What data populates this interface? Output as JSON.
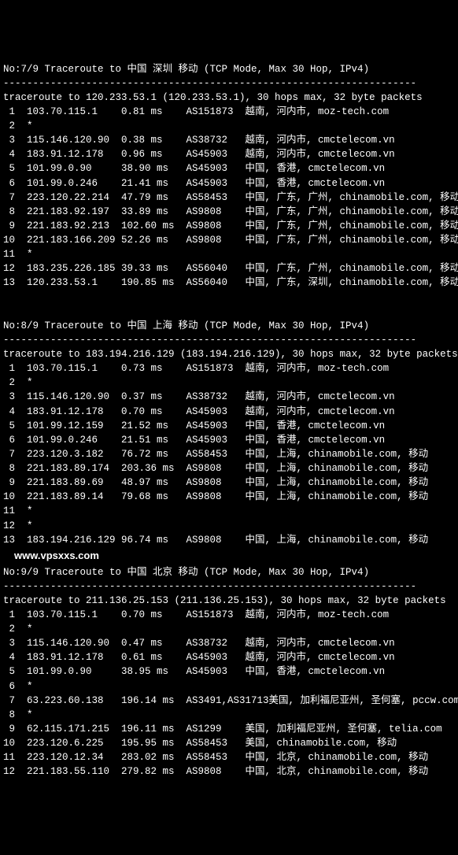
{
  "divider": "----------------------------------------------------------------------",
  "watermark": "www.vpsxxs.com",
  "traces": [
    {
      "header": "No:7/9 Traceroute to 中国 深圳 移动 (TCP Mode, Max 30 Hop, IPv4)",
      "summary": "traceroute to 120.233.53.1 (120.233.53.1), 30 hops max, 32 byte packets",
      "hops": [
        {
          "n": " 1",
          "ip": "103.70.115.1",
          "ms": "0.81 ms",
          "as": "AS151873",
          "loc": "越南, 河内市, moz-tech.com"
        },
        {
          "n": " 2",
          "ip": "*",
          "ms": "",
          "as": "",
          "loc": ""
        },
        {
          "n": " 3",
          "ip": "115.146.120.90",
          "ms": "0.38 ms",
          "as": "AS38732",
          "loc": "越南, 河内市, cmctelecom.vn"
        },
        {
          "n": " 4",
          "ip": "183.91.12.178",
          "ms": "0.96 ms",
          "as": "AS45903",
          "loc": "越南, 河内市, cmctelecom.vn"
        },
        {
          "n": " 5",
          "ip": "101.99.0.90",
          "ms": "38.90 ms",
          "as": "AS45903",
          "loc": "中国, 香港, cmctelecom.vn"
        },
        {
          "n": " 6",
          "ip": "101.99.0.246",
          "ms": "21.41 ms",
          "as": "AS45903",
          "loc": "中国, 香港, cmctelecom.vn"
        },
        {
          "n": " 7",
          "ip": "223.120.22.214",
          "ms": "47.79 ms",
          "as": "AS58453",
          "loc": "中国, 广东, 广州, chinamobile.com, 移动"
        },
        {
          "n": " 8",
          "ip": "221.183.92.197",
          "ms": "33.89 ms",
          "as": "AS9808",
          "loc": "中国, 广东, 广州, chinamobile.com, 移动"
        },
        {
          "n": " 9",
          "ip": "221.183.92.213",
          "ms": "102.60 ms",
          "as": "AS9808",
          "loc": "中国, 广东, 广州, chinamobile.com, 移动"
        },
        {
          "n": "10",
          "ip": "221.183.166.209",
          "ms": "52.26 ms",
          "as": "AS9808",
          "loc": "中国, 广东, 广州, chinamobile.com, 移动"
        },
        {
          "n": "11",
          "ip": "*",
          "ms": "",
          "as": "",
          "loc": ""
        },
        {
          "n": "12",
          "ip": "183.235.226.185",
          "ms": "39.33 ms",
          "as": "AS56040",
          "loc": "中国, 广东, 广州, chinamobile.com, 移动"
        },
        {
          "n": "13",
          "ip": "120.233.53.1",
          "ms": "190.85 ms",
          "as": "AS56040",
          "loc": "中国, 广东, 深圳, chinamobile.com, 移动"
        }
      ]
    },
    {
      "header": "No:8/9 Traceroute to 中国 上海 移动 (TCP Mode, Max 30 Hop, IPv4)",
      "summary": "traceroute to 183.194.216.129 (183.194.216.129), 30 hops max, 32 byte packets",
      "hops": [
        {
          "n": " 1",
          "ip": "103.70.115.1",
          "ms": "0.73 ms",
          "as": "AS151873",
          "loc": "越南, 河内市, moz-tech.com"
        },
        {
          "n": " 2",
          "ip": "*",
          "ms": "",
          "as": "",
          "loc": ""
        },
        {
          "n": " 3",
          "ip": "115.146.120.90",
          "ms": "0.37 ms",
          "as": "AS38732",
          "loc": "越南, 河内市, cmctelecom.vn"
        },
        {
          "n": " 4",
          "ip": "183.91.12.178",
          "ms": "0.70 ms",
          "as": "AS45903",
          "loc": "越南, 河内市, cmctelecom.vn"
        },
        {
          "n": " 5",
          "ip": "101.99.12.159",
          "ms": "21.52 ms",
          "as": "AS45903",
          "loc": "中国, 香港, cmctelecom.vn"
        },
        {
          "n": " 6",
          "ip": "101.99.0.246",
          "ms": "21.51 ms",
          "as": "AS45903",
          "loc": "中国, 香港, cmctelecom.vn"
        },
        {
          "n": " 7",
          "ip": "223.120.3.182",
          "ms": "76.72 ms",
          "as": "AS58453",
          "loc": "中国, 上海, chinamobile.com, 移动"
        },
        {
          "n": " 8",
          "ip": "221.183.89.174",
          "ms": "203.36 ms",
          "as": "AS9808",
          "loc": "中国, 上海, chinamobile.com, 移动"
        },
        {
          "n": " 9",
          "ip": "221.183.89.69",
          "ms": "48.97 ms",
          "as": "AS9808",
          "loc": "中国, 上海, chinamobile.com, 移动"
        },
        {
          "n": "10",
          "ip": "221.183.89.14",
          "ms": "79.68 ms",
          "as": "AS9808",
          "loc": "中国, 上海, chinamobile.com, 移动"
        },
        {
          "n": "11",
          "ip": "*",
          "ms": "",
          "as": "",
          "loc": ""
        },
        {
          "n": "12",
          "ip": "*",
          "ms": "",
          "as": "",
          "loc": ""
        },
        {
          "n": "13",
          "ip": "183.194.216.129",
          "ms": "96.74 ms",
          "as": "AS9808",
          "loc": "中国, 上海, chinamobile.com, 移动"
        }
      ]
    },
    {
      "header": "No:9/9 Traceroute to 中国 北京 移动 (TCP Mode, Max 30 Hop, IPv4)",
      "summary": "traceroute to 211.136.25.153 (211.136.25.153), 30 hops max, 32 byte packets",
      "hops": [
        {
          "n": " 1",
          "ip": "103.70.115.1",
          "ms": "0.70 ms",
          "as": "AS151873",
          "loc": "越南, 河内市, moz-tech.com"
        },
        {
          "n": " 2",
          "ip": "*",
          "ms": "",
          "as": "",
          "loc": ""
        },
        {
          "n": " 3",
          "ip": "115.146.120.90",
          "ms": "0.47 ms",
          "as": "AS38732",
          "loc": "越南, 河内市, cmctelecom.vn"
        },
        {
          "n": " 4",
          "ip": "183.91.12.178",
          "ms": "0.61 ms",
          "as": "AS45903",
          "loc": "越南, 河内市, cmctelecom.vn"
        },
        {
          "n": " 5",
          "ip": "101.99.0.90",
          "ms": "38.95 ms",
          "as": "AS45903",
          "loc": "中国, 香港, cmctelecom.vn"
        },
        {
          "n": " 6",
          "ip": "*",
          "ms": "",
          "as": "",
          "loc": ""
        },
        {
          "n": " 7",
          "ip": "63.223.60.138",
          "ms": "196.14 ms",
          "as": "AS3491,AS31713",
          "loc": "美国, 加利福尼亚州, 圣何塞, pccw.com"
        },
        {
          "n": " 8",
          "ip": "*",
          "ms": "",
          "as": "",
          "loc": ""
        },
        {
          "n": " 9",
          "ip": "62.115.171.215",
          "ms": "196.11 ms",
          "as": "AS1299",
          "loc": "美国, 加利福尼亚州, 圣何塞, telia.com"
        },
        {
          "n": "10",
          "ip": "223.120.6.225",
          "ms": "195.95 ms",
          "as": "AS58453",
          "loc": "美国, chinamobile.com, 移动"
        },
        {
          "n": "11",
          "ip": "223.120.12.34",
          "ms": "283.02 ms",
          "as": "AS58453",
          "loc": "中国, 北京, chinamobile.com, 移动"
        },
        {
          "n": "12",
          "ip": "221.183.55.110",
          "ms": "279.82 ms",
          "as": "AS9808",
          "loc": "中国, 北京, chinamobile.com, 移动"
        }
      ]
    }
  ]
}
